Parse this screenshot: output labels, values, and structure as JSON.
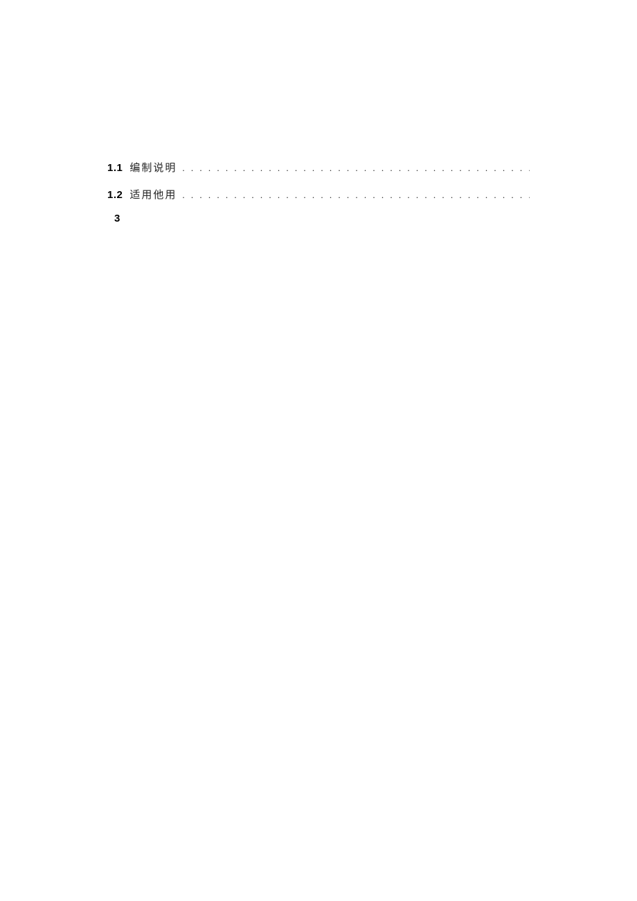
{
  "toc": {
    "entries": [
      {
        "number": "1.1",
        "title": "编制说明"
      },
      {
        "number": "1.2",
        "title": "适用他用"
      }
    ]
  },
  "pageNumber": "3",
  "dots": ". . . . . . . . . . . . . . . . . . . . . . . . . . . . . . . . . . . . . . . . . . . . . . . . . . . . . . . . . . . . . . . . . . . . . . . . . . . . . . . . . . . . . ."
}
